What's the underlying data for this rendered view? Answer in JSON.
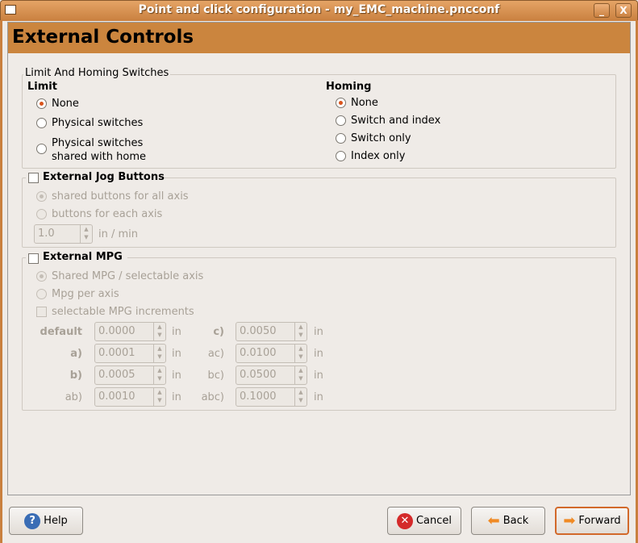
{
  "window": {
    "title": "Point and click configuration - my_EMC_machine.pncconf",
    "minimize": "_",
    "close": "X"
  },
  "header": {
    "title": "External Controls"
  },
  "limit_homing": {
    "label": "Limit And Homing Switches",
    "limit": {
      "label": "Limit",
      "options": [
        "None",
        "Physical switches",
        "Physical switches\nshared with home"
      ],
      "selected": "None"
    },
    "homing": {
      "label": "Homing",
      "options": [
        "None",
        "Switch and index",
        "Switch only",
        "Index only"
      ],
      "selected": "None"
    }
  },
  "jog": {
    "label": "External Jog Buttons",
    "checked": false,
    "options": [
      "shared buttons for all axis",
      "buttons for each axis"
    ],
    "selected": "shared buttons for all axis",
    "rate": "1.0",
    "rate_unit": "in / min"
  },
  "mpg": {
    "label": "External MPG",
    "checked": false,
    "options": [
      "Shared MPG / selectable axis",
      "Mpg per axis"
    ],
    "selected": "Shared MPG / selectable axis",
    "increments_label": "selectable MPG increments",
    "increments_checked": false,
    "increments": [
      {
        "label": "default",
        "value": "0.0000",
        "unit": "in"
      },
      {
        "label": "a)",
        "value": "0.0001",
        "unit": "in"
      },
      {
        "label": "b)",
        "value": "0.0005",
        "unit": "in"
      },
      {
        "label": "ab)",
        "value": "0.0010",
        "unit": "in"
      },
      {
        "label": "c)",
        "value": "0.0050",
        "unit": "in"
      },
      {
        "label": "ac)",
        "value": "0.0100",
        "unit": "in"
      },
      {
        "label": "bc)",
        "value": "0.0500",
        "unit": "in"
      },
      {
        "label": "abc)",
        "value": "0.1000",
        "unit": "in"
      }
    ]
  },
  "buttons": {
    "help": "Help",
    "cancel": "Cancel",
    "back": "Back",
    "forward": "Forward"
  },
  "colors": {
    "accent": "#cb853e",
    "radio_selected": "#d9541c"
  }
}
